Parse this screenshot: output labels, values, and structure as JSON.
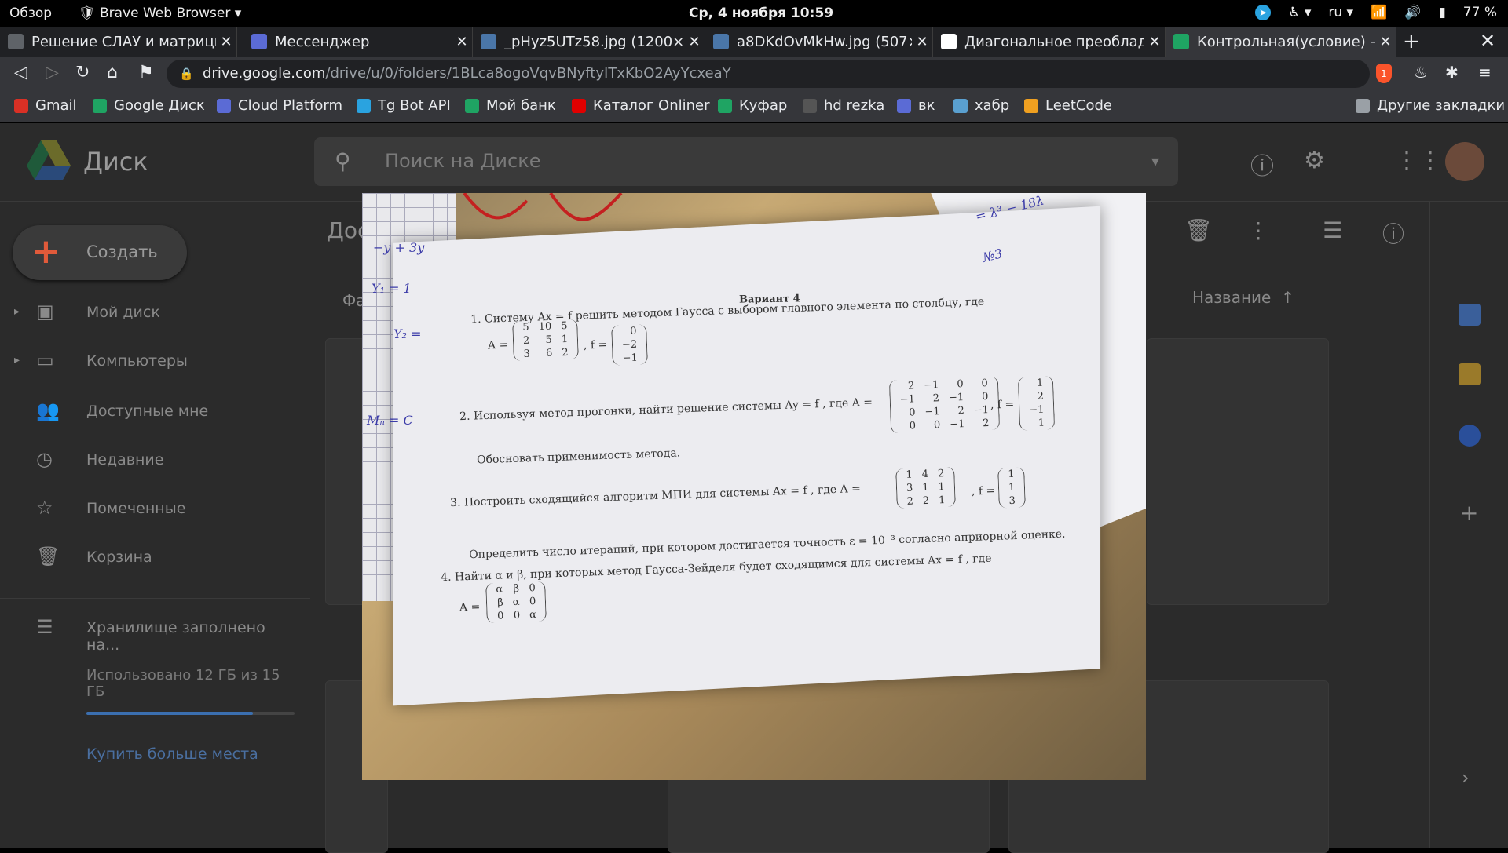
{
  "system_bar": {
    "activities": "Обзор",
    "app_name": "Brave Web Browser ▾",
    "clock": "Ср, 4 ноября  10:59",
    "lang": "ru ▾",
    "battery": "77 %"
  },
  "tabs": [
    {
      "title": "Решение СЛАУ и матриць",
      "favicon": "doc-icon",
      "fav_color": "#5f6368",
      "active": false
    },
    {
      "title": "Мессенджер",
      "favicon": "chat-icon",
      "fav_color": "#5b6bd5",
      "active": false
    },
    {
      "title": "_pHyz5UTz58.jpg (1200×1",
      "favicon": "vk-icon",
      "fav_color": "#4a76a8",
      "active": false
    },
    {
      "title": "a8DKdOvMkHw.jpg (507×",
      "favicon": "vk-icon",
      "fav_color": "#4a76a8",
      "active": false
    },
    {
      "title": "Диагональное преоблада",
      "favicon": "wikipedia-icon",
      "fav_color": "#ffffff",
      "active": false
    },
    {
      "title": "Контрольная(условие) – С",
      "favicon": "drive-icon",
      "fav_color": "#1fa463",
      "active": true
    }
  ],
  "toolbar": {
    "url_host": "drive.google.com",
    "url_path": "/drive/u/0/folders/1BLca8ogoVqvBNyftyITxKbO2AyYcxeaY",
    "shield_badge": "1"
  },
  "bookmarks": [
    {
      "label": "Gmail",
      "icon": "gmail-icon",
      "color": "#d93025"
    },
    {
      "label": "Google Диск",
      "icon": "drive-icon",
      "color": "#1fa463"
    },
    {
      "label": "Cloud Platform",
      "icon": "cloud-icon",
      "color": "#5b6bd5"
    },
    {
      "label": "Tg Bot API",
      "icon": "telegram-icon",
      "color": "#2aa3e0"
    },
    {
      "label": "Мой банк",
      "icon": "bank-icon",
      "color": "#1fa463"
    },
    {
      "label": "Каталог Onliner",
      "icon": "onliner-icon",
      "color": "#e00000"
    },
    {
      "label": "Куфар",
      "icon": "kufar-icon",
      "color": "#1fa463"
    },
    {
      "label": "hd rezka",
      "icon": "hd-icon",
      "color": "#555555"
    },
    {
      "label": "вк",
      "icon": "vk-chat-icon",
      "color": "#5b6bd5"
    },
    {
      "label": "хабр",
      "icon": "habr-icon",
      "color": "#5aa0d0"
    },
    {
      "label": "LeetCode",
      "icon": "leetcode-icon",
      "color": "#f0a020"
    }
  ],
  "other_bookmarks": "Другие закладки",
  "drive": {
    "title": "Диск",
    "search_placeholder": "Поиск на Диске",
    "new_button": "Создать",
    "content_title": "Дос",
    "filter_stub": "Фа",
    "sort_label": "Название",
    "sidebar": [
      {
        "label": "Мой диск",
        "icon": "my-drive-icon",
        "glyph": "▣",
        "arrow": "▸"
      },
      {
        "label": "Компьютеры",
        "icon": "computers-icon",
        "glyph": "▭",
        "arrow": "▸"
      },
      {
        "label": "Доступные мне",
        "icon": "shared-icon",
        "glyph": "👥",
        "arrow": ""
      },
      {
        "label": "Недавние",
        "icon": "recent-icon",
        "glyph": "◷",
        "arrow": ""
      },
      {
        "label": "Помеченные",
        "icon": "starred-icon",
        "glyph": "☆",
        "arrow": ""
      },
      {
        "label": "Корзина",
        "icon": "trash-icon",
        "glyph": "🗑",
        "arrow": ""
      }
    ],
    "storage_label": "Хранилище заполнено на...",
    "storage_used": "Использовано 12 ГБ из 15 ГБ",
    "storage_fraction": 0.8,
    "buy_more": "Купить больше места"
  },
  "photo": {
    "variant": "Вариант 4",
    "task1": "1.  Систему  Ax = f  решить методом Гаусса с выбором главного элемента по столбцу, где",
    "task1_A_label": "A =",
    "task1_A": [
      [
        "5",
        "10",
        "5"
      ],
      [
        "2",
        "5",
        "1"
      ],
      [
        "3",
        "6",
        "2"
      ]
    ],
    "task1_f_label": ", f =",
    "task1_f": [
      [
        "0"
      ],
      [
        "−2"
      ],
      [
        "−1"
      ]
    ],
    "task2": "2.  Используя метод прогонки, найти решение системы  Ay = f , где  A =",
    "task2_A": [
      [
        "2",
        "−1",
        "0",
        "0"
      ],
      [
        "−1",
        "2",
        "−1",
        "0"
      ],
      [
        "0",
        "−1",
        "2",
        "−1"
      ],
      [
        "0",
        "0",
        "−1",
        "2"
      ]
    ],
    "task2_f_label": ", f =",
    "task2_f": [
      [
        "1"
      ],
      [
        "2"
      ],
      [
        "−1"
      ],
      [
        "1"
      ]
    ],
    "task2_note": "Обосновать применимость метода.",
    "task3": "3.  Построить сходящийся алгоритм МПИ для системы  Ax = f , где  A =",
    "task3_A": [
      [
        "1",
        "4",
        "2"
      ],
      [
        "3",
        "1",
        "1"
      ],
      [
        "2",
        "2",
        "1"
      ]
    ],
    "task3_f_label": ", f =",
    "task3_f": [
      [
        "1"
      ],
      [
        "1"
      ],
      [
        "3"
      ]
    ],
    "task3_note": "Определить число итераций, при котором достигается точность  ε = 10⁻³  согласно априорной оценке.",
    "task4": "4.  Найти α и β, при которых метод Гаусса-Зейделя будет сходящимся для системы  Ax = f , где",
    "task4_A_label": "A =",
    "task4_A": [
      [
        "α",
        "β",
        "0"
      ],
      [
        "β",
        "α",
        "0"
      ],
      [
        "0",
        "0",
        "α"
      ]
    ],
    "hand_notes": [
      "= λ³ − 18λ",
      "№3",
      "Y₁ = 1",
      "Y₂ =",
      "Mₙ = C",
      "−y + 3y"
    ]
  }
}
